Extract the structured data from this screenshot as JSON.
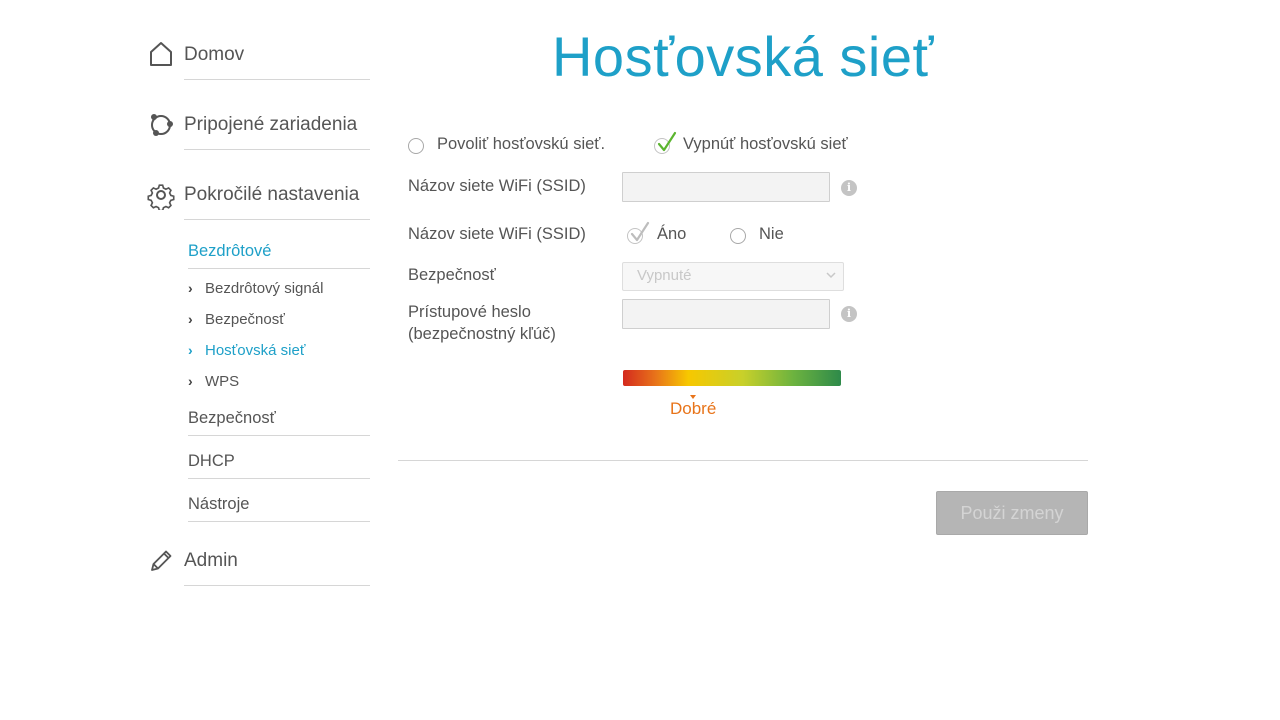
{
  "page_title": "Hosťovská sieť",
  "sidebar": {
    "home": {
      "label": "Domov",
      "icon": "home-icon"
    },
    "devices": {
      "label": "Pripojené zariadenia",
      "icon": "devices-icon"
    },
    "advanced": {
      "label": "Pokročilé nastavenia",
      "icon": "gear-icon"
    },
    "admin": {
      "label": "Admin",
      "icon": "pencil-icon"
    },
    "sections": {
      "wireless": "Bezdrôtové",
      "security": "Bezpečnosť",
      "dhcp": "DHCP",
      "tools": "Nástroje"
    },
    "wireless_items": [
      {
        "label": "Bezdrôtový signál"
      },
      {
        "label": "Bezpečnosť"
      },
      {
        "label": "Hosťovská sieť"
      },
      {
        "label": "WPS"
      }
    ]
  },
  "form": {
    "enable_label": "Povoliť hosťovskú sieť.",
    "disable_label": "Vypnúť hosťovskú sieť",
    "ssid_label": "Názov siete WiFi (SSID)",
    "ssid_value": "",
    "broadcast_label": "Názov siete WiFi (SSID)",
    "yes_label": "Áno",
    "no_label": "Nie",
    "security_label": "Bezpečnosť",
    "security_value": "Vypnuté",
    "password_label_line1": "Prístupové heslo",
    "password_label_line2": "(bezpečnostný kľúč)",
    "password_value": "",
    "info_glyph": "i",
    "strength_label": "Dobré",
    "strength_level": 0.32,
    "apply_label": "Použi zmeny"
  },
  "colors": {
    "accent": "#1ea0c8",
    "strength_text": "#e8741a",
    "check_green": "#5bb52f"
  }
}
